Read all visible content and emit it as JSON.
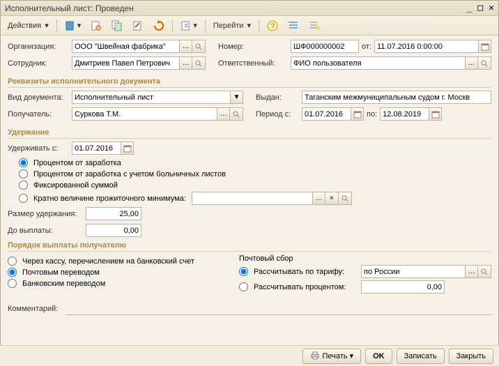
{
  "window": {
    "title": "Исполнительный лист: Проведен"
  },
  "toolbar": {
    "actions": "Действия",
    "goto": "Перейти"
  },
  "header": {
    "org_label": "Организация:",
    "org_value": "ООО \"Швейная фабрика\"",
    "number_label": "Номер:",
    "number_value": "ШФ000000002",
    "date_from_label": "от:",
    "date_from_value": "11.07.2016 0:00:00",
    "employee_label": "Сотрудник:",
    "employee_value": "Дмитриев Павел Петрович",
    "responsible_label": "Ответственный:",
    "responsible_value": "ФИО пользователя"
  },
  "docreq": {
    "section": "Реквизиты исполнительного документа",
    "kind_label": "Вид документа:",
    "kind_value": "Исполнительный лист",
    "issued_label": "Выдан:",
    "issued_value": "Таганским межмуниципальным судом г. Москв",
    "recipient_label": "Получатель:",
    "recipient_value": "Суркова Т.М.",
    "period_label": "Период с:",
    "period_from": "01.07.2016",
    "period_to_label": "по:",
    "period_to": "12.08.2019"
  },
  "withhold": {
    "section": "Удержание",
    "from_label": "Удерживать с:",
    "from_value": "01.07.2016",
    "opt_percent": "Процентом от заработка",
    "opt_percent_sick": "Процентом от заработка с учетом больничных листов",
    "opt_fixed": "Фиксированной суммой",
    "opt_multiple": "Кратно величине прожиточного минимума:",
    "size_label": "Размер удержания:",
    "size_value": "25,00",
    "until_label": "До выплаты:",
    "until_value": "0,00"
  },
  "payorder": {
    "section": "Порядок выплаты получателю",
    "opt_cash": "Через кассу, перечислением на банковский счет",
    "opt_post": "Почтовым переводом",
    "opt_bank": "Банковским переводом",
    "fee_label": "Почтовый сбор",
    "opt_tariff": "Рассчитывать по тарифу:",
    "tariff_value": "по России",
    "opt_percent_fee": "Рассчитывать процентом:",
    "percent_fee_value": "0,00"
  },
  "comment_label": "Комментарий:",
  "footer": {
    "print": "Печать",
    "ok": "OK",
    "write": "Записать",
    "close": "Закрыть"
  }
}
